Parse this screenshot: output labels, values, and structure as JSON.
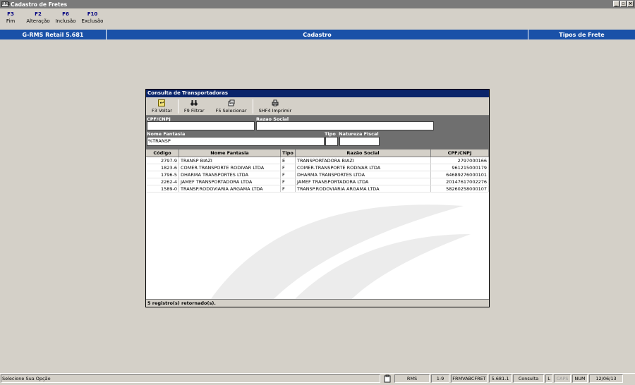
{
  "window": {
    "title": "Cadastro de Fretes",
    "icon_label": "RMS"
  },
  "fkeys": [
    {
      "key": "F3",
      "label": "Fim"
    },
    {
      "key": "F2",
      "label": "Alteração"
    },
    {
      "key": "F6",
      "label": "Inclusão"
    },
    {
      "key": "F10",
      "label": "Exclusão"
    }
  ],
  "header": {
    "app": "G-RMS Retail 5.681",
    "section": "Cadastro",
    "screen": "Tipos de Frete"
  },
  "dialog": {
    "title": "Consulta de Transportadoras",
    "toolbar": [
      {
        "label": "F3 Voltar",
        "icon": "back-icon"
      },
      {
        "label": "F9 Filtrar",
        "icon": "binoculars-icon"
      },
      {
        "label": "F5 Selecionar",
        "icon": "select-icon"
      },
      {
        "label": "SHF4 Imprimir",
        "icon": "printer-icon"
      }
    ],
    "filters": {
      "cpf_label": "CPF/CNPJ",
      "cpf_value": "",
      "razao_label": "Razao Social",
      "razao_value": "",
      "fantasia_label": "Nome Fantasia",
      "fantasia_value": "%TRANSP",
      "tipo_label": "Tipo",
      "tipo_value": "",
      "natureza_label": "Natureza Fiscal",
      "natureza_value": ""
    },
    "columns": [
      "Código",
      "Nome Fantasia",
      "Tipo",
      "Razão Social",
      "CPF/CNPJ"
    ],
    "rows": [
      {
        "codigo": "2797-9",
        "fantasia": "TRANSP BIAZI",
        "tipo": "E",
        "razao": "TRANSPORTADORA BIAZI",
        "cnpj": "2797000166"
      },
      {
        "codigo": "1823-6",
        "fantasia": "COMER.TRANSPORTE RODIVAR LTDA",
        "tipo": "F",
        "razao": "COMER.TRANSPORTE RODIVAR LTDA",
        "cnpj": "961215000179"
      },
      {
        "codigo": "1796-5",
        "fantasia": "DHARMA TRANSPORTES LTDA",
        "tipo": "F",
        "razao": "DHARMA TRANSPORTES LTDA",
        "cnpj": "64689276000101"
      },
      {
        "codigo": "2262-4",
        "fantasia": "JAMEF TRANSPORTADORA LTDA",
        "tipo": "F",
        "razao": "JAMEF TRANSPORTADORA LTDA",
        "cnpj": "20147617002276"
      },
      {
        "codigo": "1589-0",
        "fantasia": "TRANSP.RODOVIARIA ARGAMA LTDA",
        "tipo": "F",
        "razao": "TRANSP.RODOVIARIA ARGAMA LTDA",
        "cnpj": "58260258000107"
      }
    ],
    "status": "5 registro(s) retornado(s)."
  },
  "statusbar": {
    "message": "Selecione Sua Opção",
    "system": "RMS",
    "range": "1-9",
    "program": "FRMVABCFRET",
    "version": "5.681.1",
    "mode": "Consulta",
    "l": "L",
    "caps": "CAPS",
    "num": "NUM",
    "date": "12/06/13"
  }
}
